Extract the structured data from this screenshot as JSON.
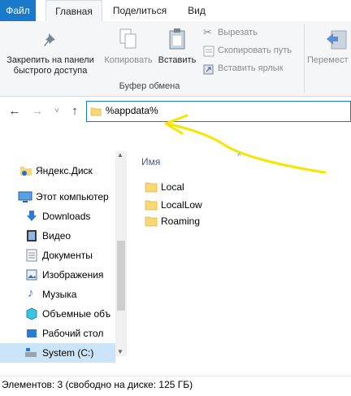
{
  "tabs": {
    "file": "Файл",
    "home": "Главная",
    "share": "Поделиться",
    "view": "Вид"
  },
  "ribbon": {
    "pin_label": "Закрепить на панели быстрого доступа",
    "copy_label": "Копировать",
    "paste_label": "Вставить",
    "cut_label": "Вырезать",
    "copy_path_label": "Скопировать путь",
    "paste_shortcut_label": "Вставить ярлык",
    "group_clipboard": "Буфер обмена",
    "move_label": "Перемест в"
  },
  "address": {
    "value": "%appdata%"
  },
  "nav": {
    "items": [
      {
        "label": "Яндекс.Диск"
      },
      {
        "label": "Этот компьютер"
      },
      {
        "label": "Downloads"
      },
      {
        "label": "Видео"
      },
      {
        "label": "Документы"
      },
      {
        "label": "Изображения"
      },
      {
        "label": "Музыка"
      },
      {
        "label": "Объемные объ"
      },
      {
        "label": "Рабочий стол"
      },
      {
        "label": "System (C:)"
      }
    ]
  },
  "content": {
    "column_name": "Имя",
    "folders": [
      {
        "name": "Local"
      },
      {
        "name": "LocalLow"
      },
      {
        "name": "Roaming"
      }
    ]
  },
  "status": {
    "text": "Элементов: 3 (свободно на диске: 125 ГБ)"
  },
  "colors": {
    "accent": "#1979ca",
    "annotation": "#f5e600",
    "folder": "#f8d775"
  }
}
